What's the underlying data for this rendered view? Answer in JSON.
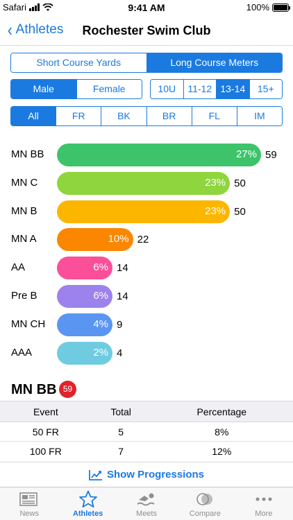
{
  "status_bar": {
    "carrier": "Safari",
    "time": "9:41 AM",
    "battery": "100%"
  },
  "nav": {
    "back_label": "Athletes",
    "title": "Rochester Swim Club"
  },
  "course_tabs": [
    {
      "label": "Short Course Yards",
      "active": false
    },
    {
      "label": "Long Course Meters",
      "active": true
    }
  ],
  "gender_tabs": [
    {
      "label": "Male",
      "active": true
    },
    {
      "label": "Female",
      "active": false
    }
  ],
  "age_tabs": [
    {
      "label": "10U",
      "active": false
    },
    {
      "label": "11-12",
      "active": false
    },
    {
      "label": "13-14",
      "active": true
    },
    {
      "label": "15+",
      "active": false
    }
  ],
  "stroke_tabs": [
    {
      "label": "All",
      "active": true
    },
    {
      "label": "FR",
      "active": false
    },
    {
      "label": "BK",
      "active": false
    },
    {
      "label": "BR",
      "active": false
    },
    {
      "label": "FL",
      "active": false
    },
    {
      "label": "IM",
      "active": false
    }
  ],
  "chart_data": {
    "type": "bar",
    "categories": [
      "MN BB",
      "MN C",
      "MN B",
      "MN A",
      "AA",
      "Pre B",
      "MN CH",
      "AAA"
    ],
    "values": [
      59,
      50,
      50,
      22,
      14,
      14,
      9,
      4
    ],
    "percent_labels": [
      "27%",
      "23%",
      "23%",
      "10%",
      "6%",
      "6%",
      "4%",
      "2%"
    ],
    "count_labels": [
      "59",
      "50",
      "50",
      "22",
      "14",
      "14",
      "9",
      "4"
    ],
    "colors": [
      "#3dc36a",
      "#8fd53e",
      "#fcb600",
      "#fb8600",
      "#fb4f9a",
      "#9c82ed",
      "#5b95f2",
      "#6fcce0"
    ]
  },
  "detail": {
    "title": "MN BB",
    "badge": "59",
    "columns": [
      "Event",
      "Total",
      "Percentage"
    ],
    "rows": [
      [
        "50 FR",
        "5",
        "8%"
      ],
      [
        "100 FR",
        "7",
        "12%"
      ]
    ],
    "show_progressions": "Show Progressions"
  },
  "tab_bar": [
    {
      "label": "News",
      "icon": "news-icon",
      "active": false
    },
    {
      "label": "Athletes",
      "icon": "star-icon",
      "active": true
    },
    {
      "label": "Meets",
      "icon": "swimmer-icon",
      "active": false
    },
    {
      "label": "Compare",
      "icon": "compare-icon",
      "active": false
    },
    {
      "label": "More",
      "icon": "more-icon",
      "active": false
    }
  ],
  "colors": {
    "accent": "#1a7ae0",
    "badge": "#e0222b"
  }
}
